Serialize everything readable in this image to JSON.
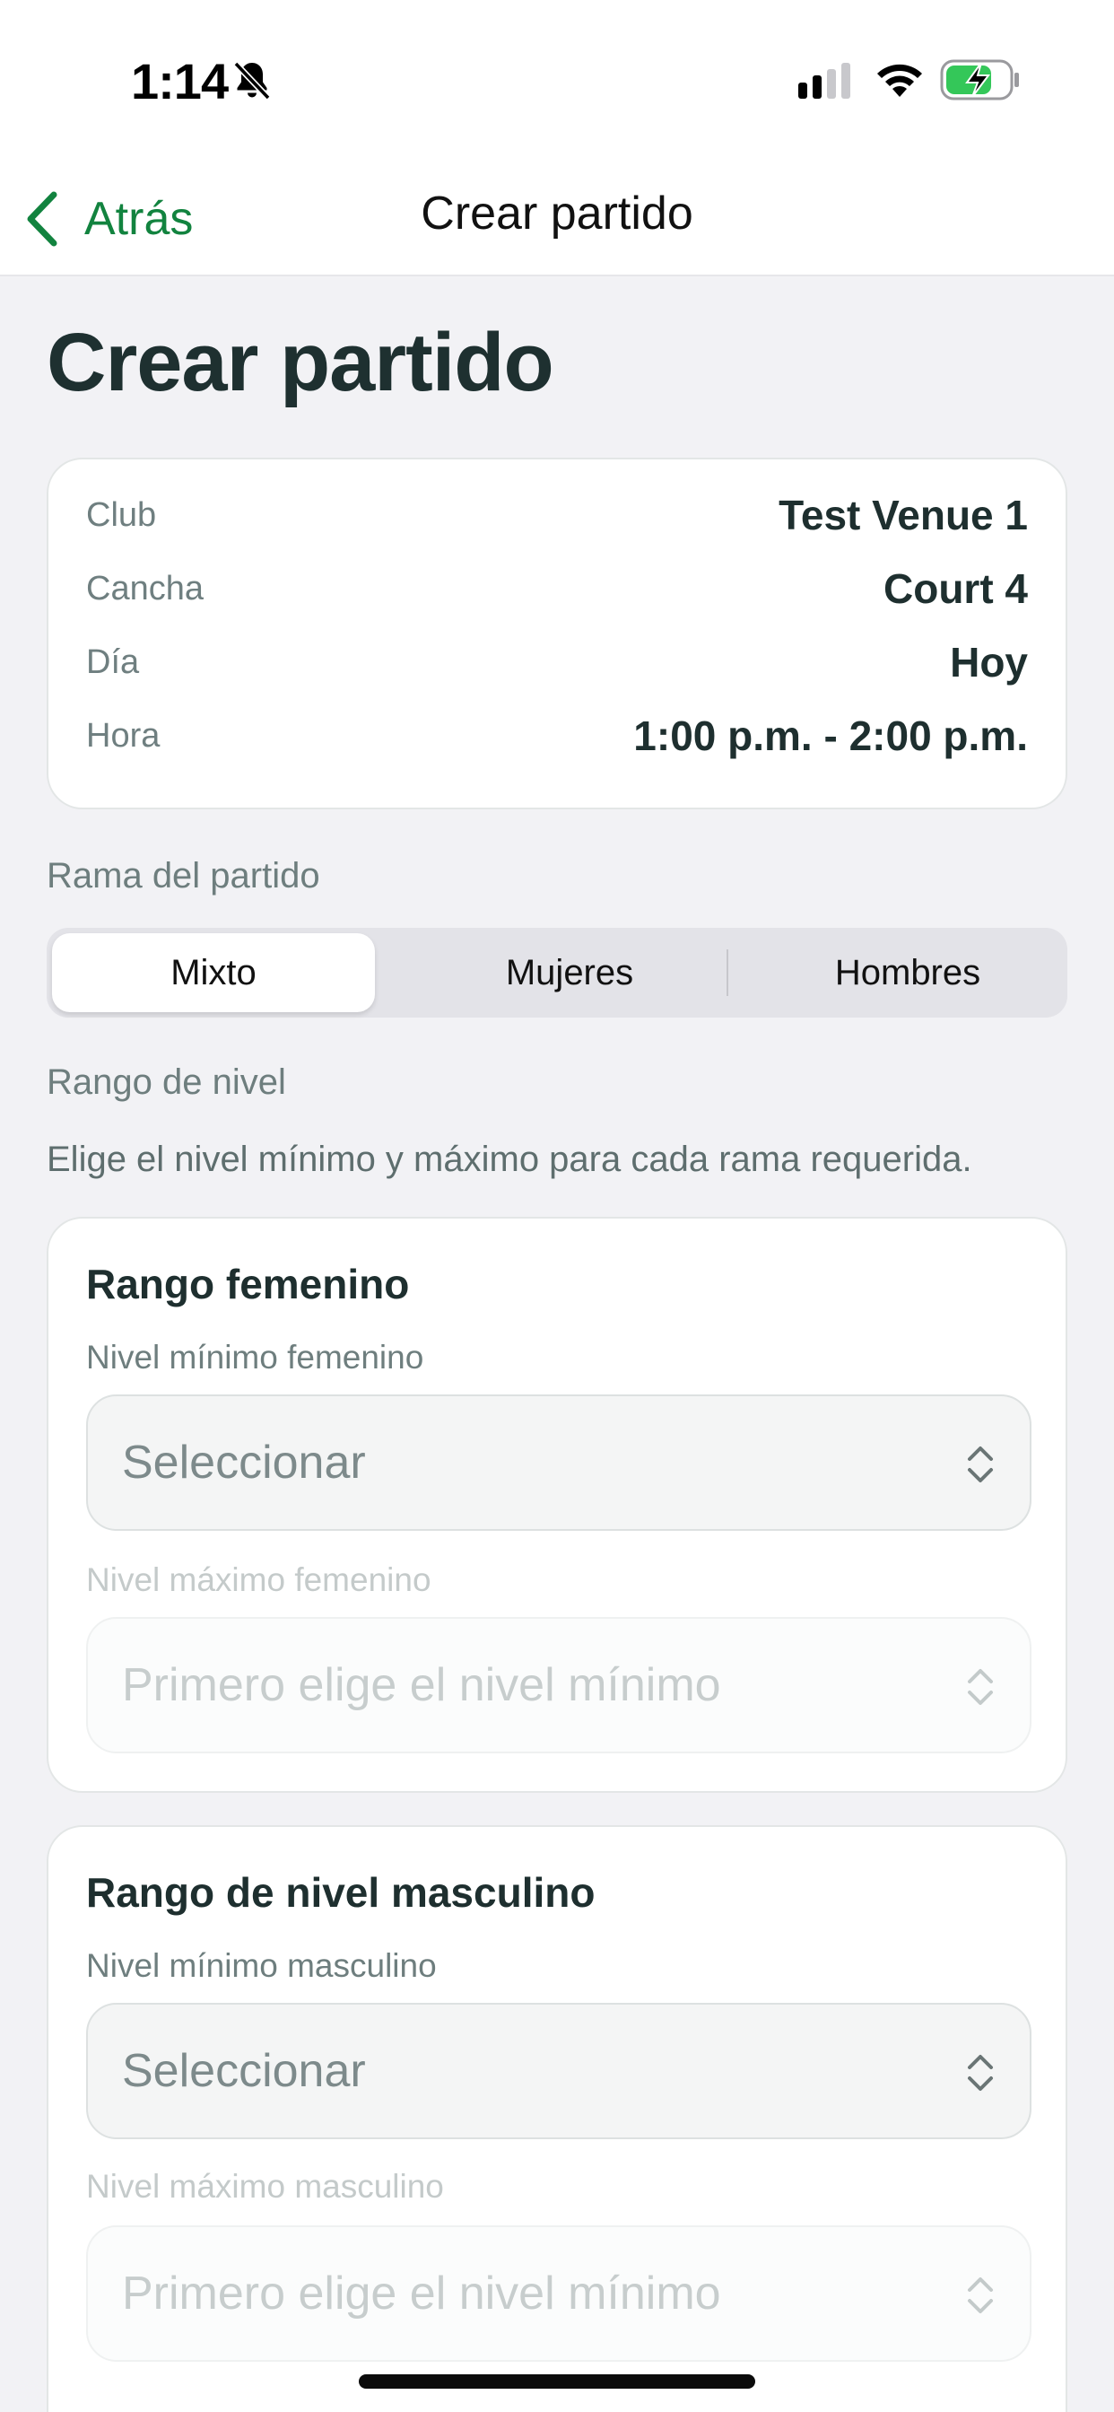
{
  "status_bar": {
    "time": "1:14"
  },
  "nav": {
    "back_label": "Atrás",
    "title": "Crear partido"
  },
  "page": {
    "title": "Crear partido"
  },
  "summary": {
    "rows": [
      {
        "label": "Club",
        "value": "Test Venue 1"
      },
      {
        "label": "Cancha",
        "value": "Court 4"
      },
      {
        "label": "Día",
        "value": "Hoy"
      },
      {
        "label": "Hora",
        "value": "1:00 p.m. - 2:00 p.m."
      }
    ]
  },
  "branch": {
    "label": "Rama del partido",
    "options": [
      "Mixto",
      "Mujeres",
      "Hombres"
    ],
    "selected": "Mixto"
  },
  "level_range": {
    "label": "Rango de nivel",
    "helper": "Elige el nivel mínimo y máximo para cada rama requerida."
  },
  "female": {
    "title": "Rango femenino",
    "min_label": "Nivel mínimo femenino",
    "min_value": "Seleccionar",
    "max_label": "Nivel máximo femenino",
    "max_value": "Primero elige el nivel mínimo"
  },
  "male": {
    "title": "Rango de nivel masculino",
    "min_label": "Nivel mínimo masculino",
    "min_value": "Seleccionar",
    "max_label": "Nivel máximo masculino",
    "max_value": "Primero elige el nivel mínimo"
  },
  "colors": {
    "accent": "#12833f",
    "battery_fill": "#34c759"
  }
}
